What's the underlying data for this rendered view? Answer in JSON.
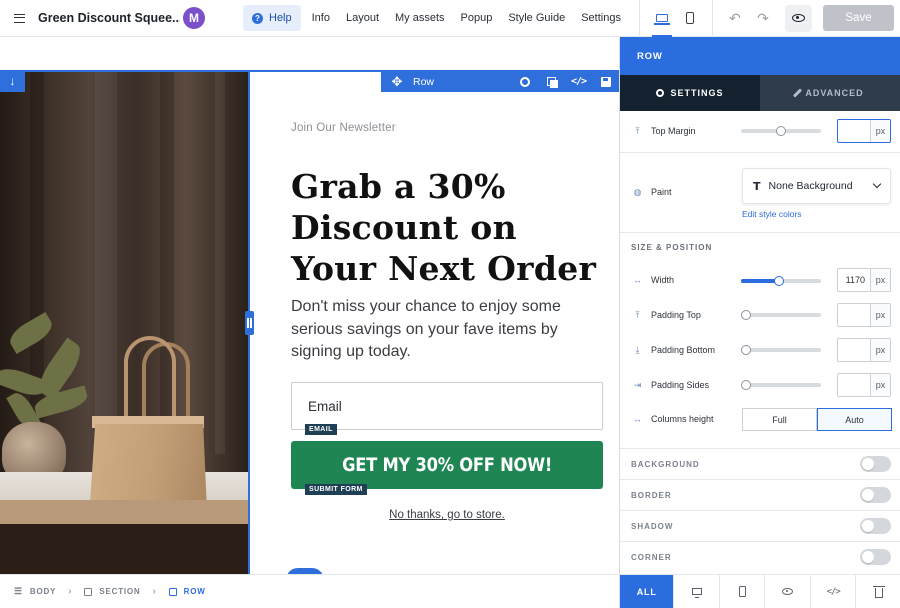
{
  "topbar": {
    "title": "Green Discount Squee...",
    "avatar_letter": "M",
    "nav": [
      "Help",
      "Info",
      "Layout",
      "My assets",
      "Popup",
      "Style Guide",
      "Settings"
    ],
    "help_icon": "?",
    "undo_icon": "↶",
    "redo_icon": "↷",
    "save_label": "Save"
  },
  "canvas": {
    "row_toolbar_label": "Row",
    "move_icon": "✥",
    "code_icon": "</>",
    "newsletter": "Join Our Newsletter",
    "headline": "Grab a 30% Discount on Your Next Order",
    "subtext": "Don't miss your chance to enjoy some serious savings on your fave items by signing up today.",
    "email_placeholder": "Email",
    "email_tag": "EMAIL",
    "cta_label": "GET MY 30% OFF NOW!",
    "submit_tag": "SUBMIT FORM",
    "decline_link": "No thanks, go to store.",
    "cta_color": "#1f8552"
  },
  "breadcrumb": {
    "items": [
      "BODY",
      "SECTION",
      "ROW"
    ],
    "separator": "›"
  },
  "panel": {
    "header": "ROW",
    "tabs": [
      "SETTINGS",
      "ADVANCED"
    ],
    "top_margin_label": "Top Margin",
    "top_margin_value": "",
    "unit": "px",
    "paint_label": "Paint",
    "paint_value": "None Background",
    "paint_icon": "T",
    "edit_colors": "Edit style colors",
    "size_section": "SIZE & POSITION",
    "width_label": "Width",
    "width_value": "1170",
    "padding_top_label": "Padding Top",
    "padding_bottom_label": "Padding Bottom",
    "padding_sides_label": "Padding Sides",
    "columns_height_label": "Columns height",
    "columns_height_options": [
      "Full",
      "Auto"
    ],
    "toggles": [
      "BACKGROUND",
      "BORDER",
      "SHADOW",
      "CORNER"
    ],
    "footer_all": "ALL",
    "accent": "#2b6cde"
  }
}
